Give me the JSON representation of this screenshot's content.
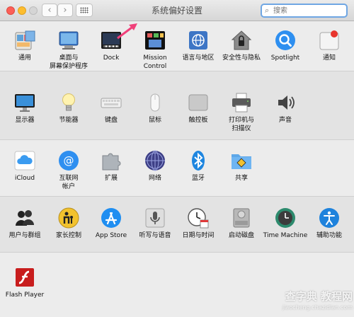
{
  "window": {
    "title": "系统偏好设置"
  },
  "toolbar": {
    "back": "‹",
    "forward": "›"
  },
  "search": {
    "placeholder": "搜索"
  },
  "rows": [
    [
      {
        "key": "general",
        "label": "通用"
      },
      {
        "key": "desktop",
        "label": "桌面与\n屏幕保护程序"
      },
      {
        "key": "dock",
        "label": "Dock"
      },
      {
        "key": "mission",
        "label": "Mission\nControl"
      },
      {
        "key": "language",
        "label": "语言与地区"
      },
      {
        "key": "security",
        "label": "安全性与隐私"
      },
      {
        "key": "spotlight",
        "label": "Spotlight"
      },
      {
        "key": "notifications",
        "label": "通知"
      }
    ],
    [
      {
        "key": "displays",
        "label": "显示器"
      },
      {
        "key": "energy",
        "label": "节能器"
      },
      {
        "key": "keyboard",
        "label": "键盘"
      },
      {
        "key": "mouse",
        "label": "鼠标"
      },
      {
        "key": "trackpad",
        "label": "触控板"
      },
      {
        "key": "printers",
        "label": "打印机与\n扫描仪"
      },
      {
        "key": "sound",
        "label": "声音"
      }
    ],
    [
      {
        "key": "icloud",
        "label": "iCloud"
      },
      {
        "key": "internet",
        "label": "互联网\n帐户"
      },
      {
        "key": "extensions",
        "label": "扩展"
      },
      {
        "key": "network",
        "label": "网络"
      },
      {
        "key": "bluetooth",
        "label": "蓝牙"
      },
      {
        "key": "sharing",
        "label": "共享"
      }
    ],
    [
      {
        "key": "users",
        "label": "用户与群组"
      },
      {
        "key": "parental",
        "label": "家长控制"
      },
      {
        "key": "appstore",
        "label": "App Store"
      },
      {
        "key": "dictation",
        "label": "听写与语音"
      },
      {
        "key": "datetime",
        "label": "日期与时间"
      },
      {
        "key": "startup",
        "label": "启动磁盘"
      },
      {
        "key": "timemachine",
        "label": "Time Machine"
      },
      {
        "key": "accessibility",
        "label": "辅助功能"
      }
    ],
    [
      {
        "key": "flash",
        "label": "Flash Player"
      }
    ]
  ],
  "watermark": {
    "line1": "查字典 教程网",
    "line2": "jiaocheng.chazidian.com"
  },
  "colors": {
    "arrow": "#f0407a",
    "accent": "#1a8ad6"
  }
}
